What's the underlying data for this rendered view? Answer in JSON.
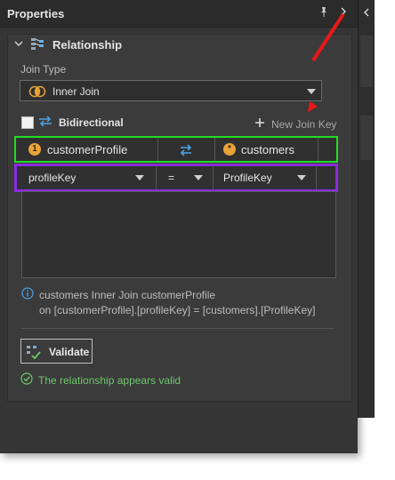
{
  "panel": {
    "title": "Properties"
  },
  "relationship": {
    "section_title": "Relationship",
    "join_type_label": "Join Type",
    "join_type_value": "Inner Join",
    "bidirectional_label": "Bidirectional",
    "new_join_key_label": "New Join Key",
    "left_table": {
      "badge": "1",
      "name": "customerProfile"
    },
    "right_table": {
      "badge": "*",
      "name": "customers"
    },
    "key_row": {
      "left_key": "profileKey",
      "operator": "=",
      "right_key": "ProfileKey"
    },
    "info_line1": "customers Inner Join customerProfile",
    "info_line2": "on [customerProfile].[profileKey] = [customers].[ProfileKey]",
    "validate_label": "Validate",
    "status_text": "The relationship appears valid"
  },
  "colors": {
    "highlight_green": "#22dd22",
    "highlight_purple": "#8a2be2",
    "annotation_arrow": "#e81818",
    "status_green": "#6cc86c"
  }
}
